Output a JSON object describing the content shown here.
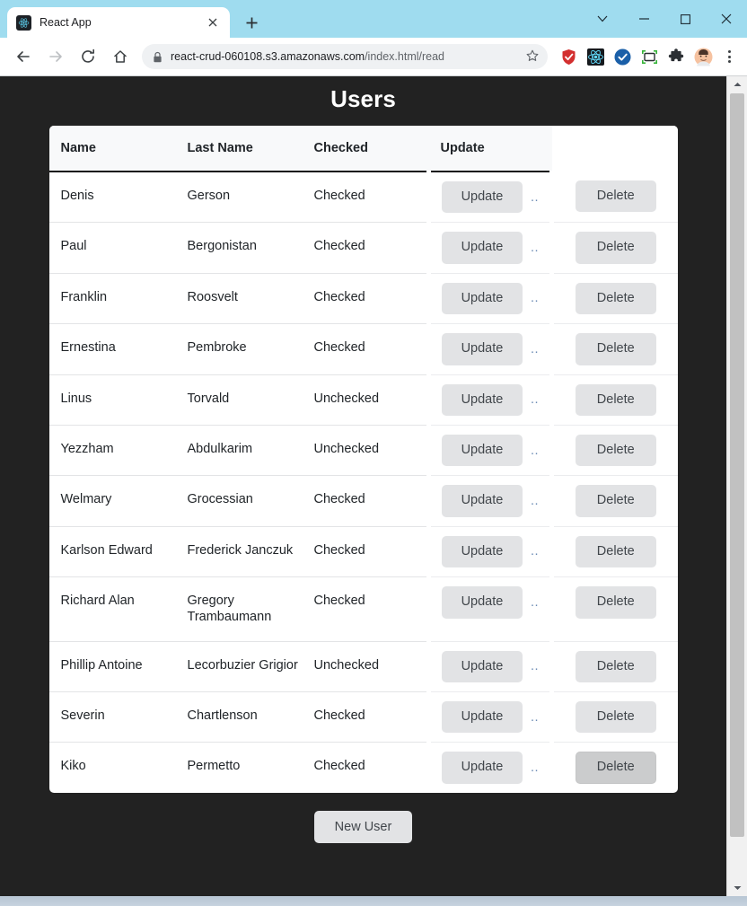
{
  "browser": {
    "tab": {
      "title": "React App",
      "favicon_icon": "react-logo-icon",
      "close_icon": "close-icon"
    },
    "new_tab_icon": "plus-icon",
    "window_controls": {
      "expand": "chevron-down-icon",
      "minimize": "minimize-icon",
      "maximize": "maximize-icon",
      "close": "close-icon"
    },
    "nav": {
      "back_icon": "arrow-left-icon",
      "forward_icon": "arrow-right-icon",
      "reload_icon": "reload-icon",
      "home_icon": "home-icon"
    },
    "omnibox": {
      "lock_icon": "lock-icon",
      "url_host": "react-crud-060108.s3.amazonaws.com",
      "url_path": "/index.html/read",
      "bookmark_icon": "star-icon"
    },
    "extensions": [
      {
        "name": "shield-check-icon"
      },
      {
        "name": "react-devtools-icon"
      },
      {
        "name": "check-circle-icon"
      },
      {
        "name": "screen-capture-icon"
      },
      {
        "name": "puzzle-piece-icon"
      },
      {
        "name": "profile-avatar-icon"
      }
    ],
    "menu_icon": "kebab-menu-icon"
  },
  "page": {
    "title": "Users",
    "background_color": "#222222",
    "card_background": "#ffffff",
    "table": {
      "headers": [
        "Name",
        "Last Name",
        "Checked",
        "Update",
        ""
      ],
      "rows": [
        {
          "name": "Denis",
          "last_name": "Gerson",
          "checked": "Checked",
          "update_label": "Update",
          "dots": "..",
          "delete_label": "Delete",
          "delete_active": false
        },
        {
          "name": "Paul",
          "last_name": "Bergonistan",
          "checked": "Checked",
          "update_label": "Update",
          "dots": "..",
          "delete_label": "Delete",
          "delete_active": false
        },
        {
          "name": "Franklin",
          "last_name": "Roosvelt",
          "checked": "Checked",
          "update_label": "Update",
          "dots": "..",
          "delete_label": "Delete",
          "delete_active": false
        },
        {
          "name": "Ernestina",
          "last_name": "Pembroke",
          "checked": "Checked",
          "update_label": "Update",
          "dots": "..",
          "delete_label": "Delete",
          "delete_active": false
        },
        {
          "name": "Linus",
          "last_name": "Torvald",
          "checked": "Unchecked",
          "update_label": "Update",
          "dots": "..",
          "delete_label": "Delete",
          "delete_active": false
        },
        {
          "name": "Yezzham",
          "last_name": "Abdulkarim",
          "checked": "Unchecked",
          "update_label": "Update",
          "dots": "..",
          "delete_label": "Delete",
          "delete_active": false
        },
        {
          "name": "Welmary",
          "last_name": "Grocessian",
          "checked": "Checked",
          "update_label": "Update",
          "dots": "..",
          "delete_label": "Delete",
          "delete_active": false
        },
        {
          "name": "Karlson Edward",
          "last_name": "Frederick Janczuk",
          "checked": "Checked",
          "update_label": "Update",
          "dots": "..",
          "delete_label": "Delete",
          "delete_active": false
        },
        {
          "name": "Richard Alan",
          "last_name": "Gregory Trambaumann",
          "checked": "Checked",
          "update_label": "Update",
          "dots": "..",
          "delete_label": "Delete",
          "delete_active": false
        },
        {
          "name": "Phillip Antoine",
          "last_name": "Lecorbuzier Grigior",
          "checked": "Unchecked",
          "update_label": "Update",
          "dots": "..",
          "delete_label": "Delete",
          "delete_active": false
        },
        {
          "name": "Severin",
          "last_name": "Chartlenson",
          "checked": "Checked",
          "update_label": "Update",
          "dots": "..",
          "delete_label": "Delete",
          "delete_active": false
        },
        {
          "name": "Kiko",
          "last_name": "Permetto",
          "checked": "Checked",
          "update_label": "Update",
          "dots": "..",
          "delete_label": "Delete",
          "delete_active": true
        }
      ]
    },
    "new_user_label": "New User",
    "scrollbar": {
      "up_icon": "caret-up-icon",
      "down_icon": "caret-down-icon"
    }
  }
}
